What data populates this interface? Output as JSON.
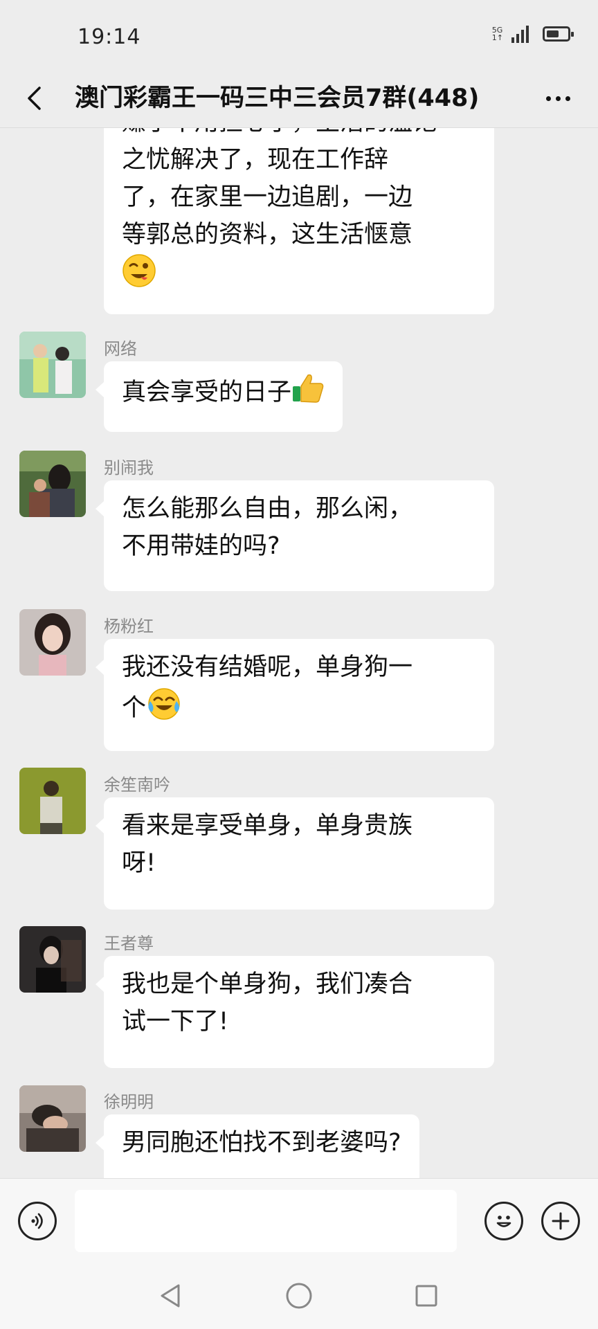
{
  "status_bar": {
    "time": "19:14",
    "network": "5G",
    "network_sub": "1↑",
    "signal_bars": 4,
    "battery_level": 0.55
  },
  "header": {
    "title": "澳门彩霸王一码三中三会员7群(448)"
  },
  "messages": [
    {
      "sender": "",
      "lines": [
        "赚了不用担心了，生活的温饱",
        "之忧解决了，现在工作辞",
        "了，在家里一边追剧，一边",
        "等郭总的资料，这生活惬意"
      ],
      "emoji": "wink-tongue-emoji"
    },
    {
      "sender": "网络",
      "lines": [
        "真会享受的日子"
      ],
      "emoji": "thumbs-up-emoji"
    },
    {
      "sender": "别闹我",
      "lines": [
        "怎么能那么自由，那么闲，",
        "不用带娃的吗?"
      ]
    },
    {
      "sender": "杨粉红",
      "lines": [
        "我还没有结婚呢，单身狗一",
        "个"
      ],
      "emoji": "laughing-crying-emoji"
    },
    {
      "sender": "余笙南吟",
      "lines": [
        "看来是享受单身，单身贵族",
        "呀!"
      ]
    },
    {
      "sender": "王者尊",
      "lines": [
        "我也是个单身狗，我们凑合",
        "试一下了!"
      ]
    },
    {
      "sender": "徐明明",
      "lines": [
        "男同胞还怕找不到老婆吗?"
      ]
    }
  ],
  "input_bar": {
    "voice_icon": "voice-icon",
    "emoji_icon": "emoji-icon",
    "plus_icon": "plus-icon",
    "placeholder": ""
  },
  "nav_bar": {
    "back_icon": "triangle-back-icon",
    "home_icon": "circle-home-icon",
    "recents_icon": "square-recents-icon"
  }
}
